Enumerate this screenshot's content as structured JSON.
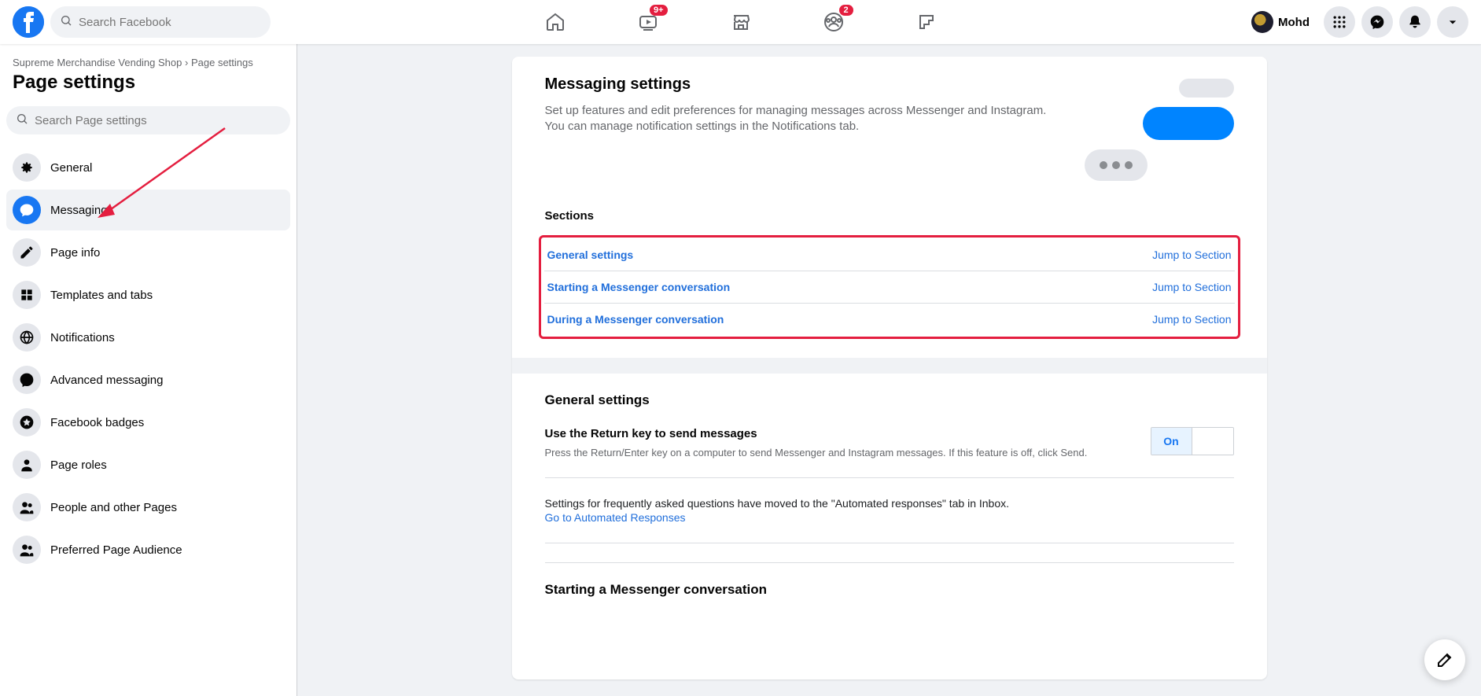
{
  "topbar": {
    "search_placeholder": "Search Facebook",
    "badge_watch": "9+",
    "badge_groups": "2",
    "profile_name": "Mohd"
  },
  "leftbar": {
    "breadcrumb_page": "Supreme Merchandise Vending Shop",
    "breadcrumb_separator": "›",
    "breadcrumb_current": "Page settings",
    "title": "Page settings",
    "search_placeholder": "Search Page settings",
    "items": [
      {
        "label": "General"
      },
      {
        "label": "Messaging"
      },
      {
        "label": "Page info"
      },
      {
        "label": "Templates and tabs"
      },
      {
        "label": "Notifications"
      },
      {
        "label": "Advanced messaging"
      },
      {
        "label": "Facebook badges"
      },
      {
        "label": "Page roles"
      },
      {
        "label": "People and other Pages"
      },
      {
        "label": "Preferred Page Audience"
      }
    ]
  },
  "main": {
    "heading": "Messaging settings",
    "subheading": "Set up features and edit preferences for managing messages across Messenger and Instagram. You can manage notification settings in the Notifications tab.",
    "sections_label": "Sections",
    "jump_label": "Jump to Section",
    "sections": [
      {
        "name": "General settings"
      },
      {
        "name": "Starting a Messenger conversation"
      },
      {
        "name": "During a Messenger conversation"
      }
    ],
    "general_heading": "General settings",
    "return_key": {
      "title": "Use the Return key to send messages",
      "desc": "Press the Return/Enter key on a computer to send Messenger and Instagram messages. If this feature is off, click Send.",
      "toggle_value": "On"
    },
    "faq_text": "Settings for frequently asked questions have moved to the \"Automated responses\" tab in Inbox.",
    "faq_link": "Go to Automated Responses",
    "starting_heading": "Starting a Messenger conversation"
  }
}
